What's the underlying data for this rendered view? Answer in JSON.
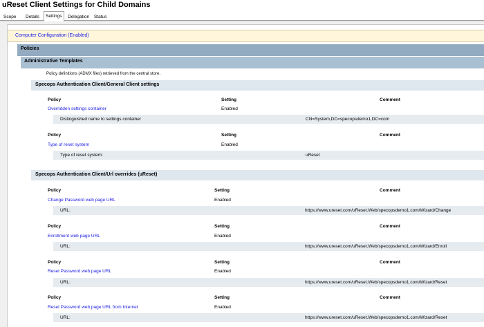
{
  "window": {
    "title": "uReset Client Settings for Child Domains"
  },
  "tabs": [
    {
      "label": "Scope",
      "active": false
    },
    {
      "label": "Details",
      "active": false
    },
    {
      "label": "Settings",
      "active": true
    },
    {
      "label": "Delegation",
      "active": false
    },
    {
      "label": "Status",
      "active": false
    }
  ],
  "report": {
    "computer_config": "Computer Configuration (Enabled)",
    "policies": "Policies",
    "admin_templates": "Administrative Templates",
    "note": "Policy definitions (ADMX files) retrieved from the central store.",
    "col_policy": "Policy",
    "col_setting": "Setting",
    "col_comment": "Comment",
    "sections": [
      {
        "title": "Specops Authentication Client/General Client settings",
        "policies": [
          {
            "name": "Overridden settings container",
            "setting": "Enabled",
            "detail_label": "Distinguished name to settings container",
            "detail_value": "CN=System,DC=specopsdemo1,DC=com"
          },
          {
            "name": "Type of reset system",
            "setting": "Enabled",
            "detail_label": "Type of reset system:",
            "detail_value": "uReset"
          }
        ]
      },
      {
        "title": "Specops Authentication Client/Url overrides (uReset)",
        "policies": [
          {
            "name": "Change Password web page URL",
            "setting": "Enabled",
            "detail_label": "URL:",
            "detail_value": "https://www.ureset.com/uReset.Web/specopsdemo1.com/Wizard/Change"
          },
          {
            "name": "Enrollment web page URL",
            "setting": "Enabled",
            "detail_label": "URL:",
            "detail_value": "https://www.ureset.com/uReset.Web/specopsdemo1.com/Wizard/Enroll"
          },
          {
            "name": "Reset Password web page URL",
            "setting": "Enabled",
            "detail_label": "URL:",
            "detail_value": "https://www.ureset.com/uReset.Web/specopsdemo1.com/Wizard/Reset"
          },
          {
            "name": "Reset Password web page URL from Internet",
            "setting": "Enabled",
            "detail_label": "URL:",
            "detail_value": "https://www.ureset.com/uReset.Web/specopsdemo1.com/Wizard/Reset"
          }
        ]
      }
    ]
  }
}
